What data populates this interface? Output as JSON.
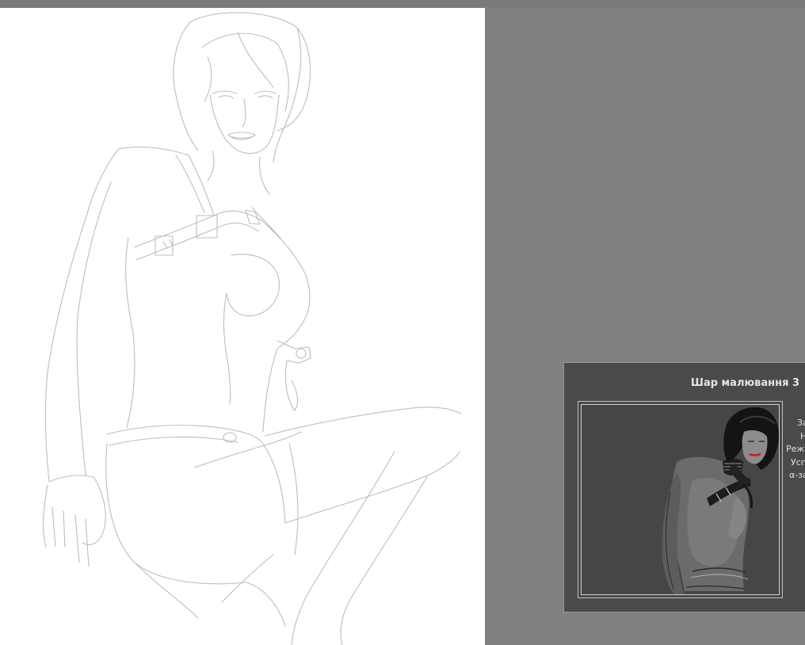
{
  "layer_popup": {
    "title": "Шар малювання 3",
    "properties": [
      "За",
      "Н",
      "Реж.",
      "Усп",
      "α-за"
    ]
  },
  "icons": {
    "canvas": "sketch-drawing",
    "thumbnail": "layer-preview-image"
  }
}
